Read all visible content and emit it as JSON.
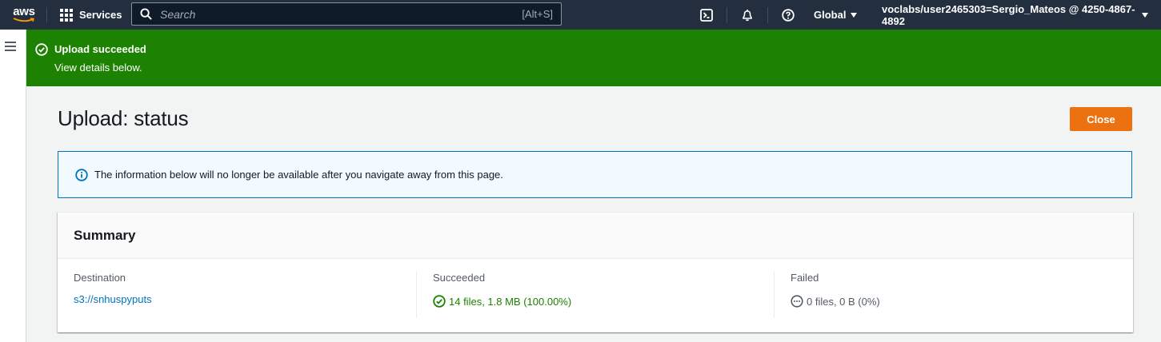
{
  "nav": {
    "logo": "aws",
    "services_label": "Services",
    "search_placeholder": "Search",
    "search_shortcut": "[Alt+S]",
    "icons": [
      "cloudshell-icon",
      "bell-icon",
      "help-icon"
    ],
    "region_label": "Global",
    "account_label": "voclabs/user2465303=Sergio_Mateos @ 4250-4867-4892"
  },
  "flash": {
    "title": "Upload succeeded",
    "subtitle": "View details below.",
    "color": "#1d8102"
  },
  "page": {
    "title": "Upload: status",
    "close_label": "Close",
    "info_text": "The information below will no longer be available after you navigate away from this page."
  },
  "summary": {
    "title": "Summary",
    "destination_label": "Destination",
    "destination_value": "s3://snhuspyputs",
    "succeeded_label": "Succeeded",
    "succeeded_value": "14 files, 1.8 MB (100.00%)",
    "failed_label": "Failed",
    "failed_value": "0 files, 0 B (0%)"
  },
  "colors": {
    "nav_bg": "#232f3e",
    "accent": "#ec7211",
    "success": "#1d8102",
    "info_border": "#0073bb",
    "link": "#0073bb"
  }
}
